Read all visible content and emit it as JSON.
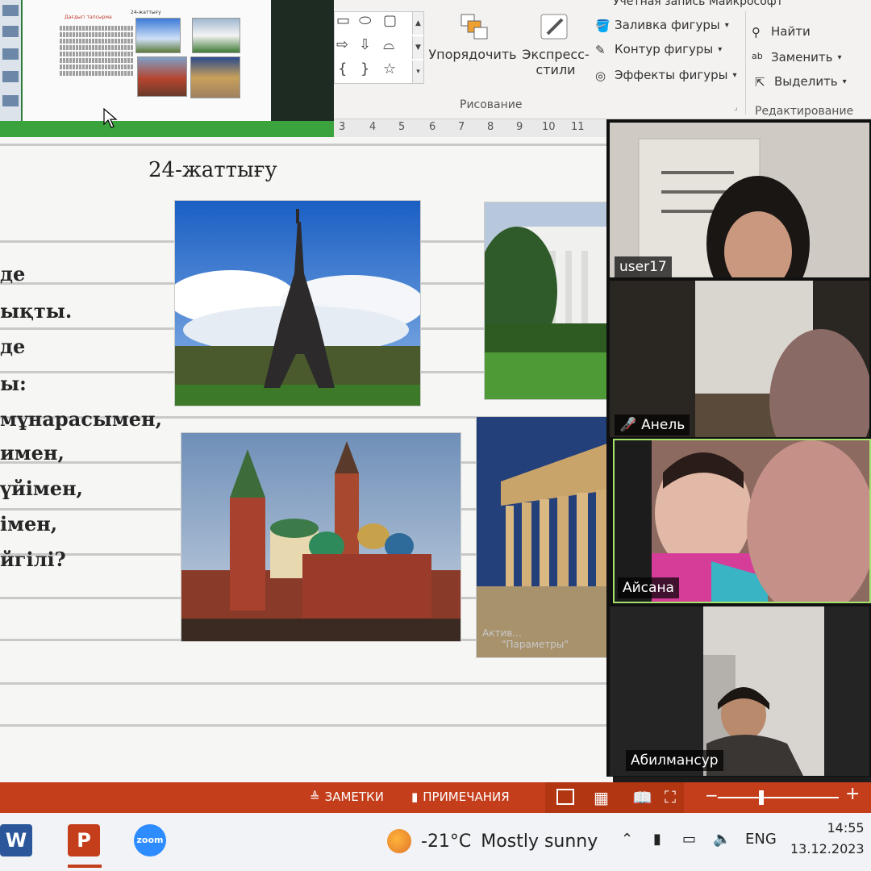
{
  "ribbon": {
    "account_label": "Учетная запись Майкрософт",
    "arrange_label": "Упорядочить",
    "quick_styles_label_1": "Экспресс-",
    "quick_styles_label_2": "стили",
    "shape_fill_label": "Заливка фигуры",
    "shape_outline_label": "Контур фигуры",
    "shape_effects_label": "Эффекты фигуры",
    "drawing_group_label": "Рисование",
    "find_label": "Найти",
    "replace_label": "Заменить",
    "select_label": "Выделить",
    "editing_group_label": "Редактирование"
  },
  "thumbnail": {
    "title": "Дағдыгі тапсырма",
    "title2": "24-жаттығу"
  },
  "ruler": [
    "3",
    "4",
    "5",
    "6",
    "7",
    "8",
    "9",
    "10",
    "11"
  ],
  "slide": {
    "title": "24-жаттығу",
    "lines": [
      "де",
      "ықты.",
      "де",
      "ы:",
      "мұнарасымен,",
      "имен,",
      "үйімен,",
      "імен,",
      "йгілі?"
    ],
    "watermark_1": "Актив...",
    "watermark_2": "\"Параметры\""
  },
  "zoom": {
    "participants": [
      {
        "name": "user17",
        "muted": false,
        "active": false
      },
      {
        "name": "Анель",
        "muted": true,
        "active": false
      },
      {
        "name": "Айсана",
        "muted": false,
        "active": true
      },
      {
        "name": "Абилмансур",
        "muted": false,
        "active": false
      }
    ]
  },
  "statusbar": {
    "notes_label": "ЗАМЕТКИ",
    "comments_label": "ПРИМЕЧАНИЯ",
    "zoom_minus": "−",
    "zoom_plus": "+",
    "zoom_level": 0.36
  },
  "taskbar": {
    "apps": [
      {
        "name": "word",
        "label": "W",
        "color": "#2b579a"
      },
      {
        "name": "powerpoint",
        "label": "P",
        "color": "#c43e1c"
      },
      {
        "name": "zoom",
        "label": "zoom",
        "color": "#2d8cff"
      }
    ],
    "weather_temp": "-21°C",
    "weather_desc": "Mostly sunny",
    "language": "ENG",
    "time": "14:55",
    "date": "13.12.2023"
  }
}
